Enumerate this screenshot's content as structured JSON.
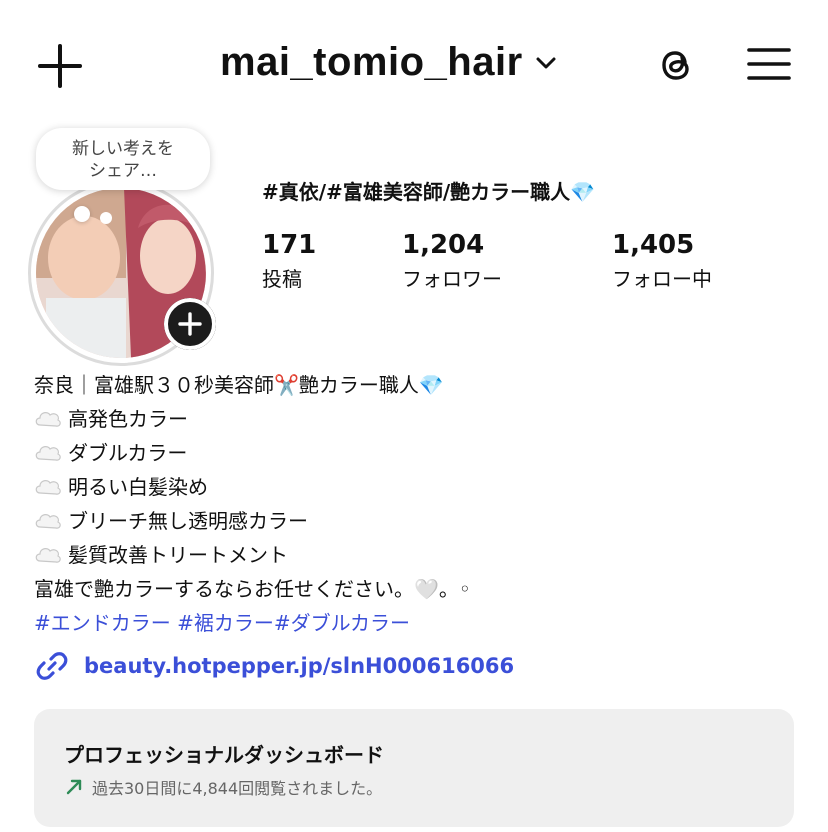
{
  "header": {
    "username": "mai_tomio_hair",
    "icons": [
      "plus-icon",
      "chevron-down-icon",
      "threads-icon",
      "menu-icon"
    ]
  },
  "note": {
    "line1": "新しい考えを",
    "line2": "シェア…"
  },
  "profile": {
    "category": "#真依/#富雄美容師/艶カラー職人💎",
    "stats": [
      {
        "value": "171",
        "label": "投稿"
      },
      {
        "value": "1,204",
        "label": "フォロワー"
      },
      {
        "value": "1,405",
        "label": "フォロー中"
      }
    ]
  },
  "bio": {
    "line1": "奈良｜富雄駅３０秒美容師✂️艶カラー職人💎",
    "items": [
      "高発色カラー",
      "ダブルカラー",
      "明るい白髪染め",
      "ブリーチ無し透明感カラー",
      "髪質改善トリートメント"
    ],
    "closing": "富雄で艶カラーするならお任せください。🤍。◦",
    "hashtags": "#エンドカラー #裾カラー#ダブルカラー"
  },
  "link": {
    "url": "beauty.hotpepper.jp/slnH000616066"
  },
  "dashboard": {
    "title": "プロフェッショナルダッシュボード",
    "subtitle": "過去30日間に4,844回閲覧されました。"
  },
  "colors": {
    "link": "#3b4fd8",
    "trend": "#2e8b57",
    "dashboard_bg": "#efefef"
  }
}
